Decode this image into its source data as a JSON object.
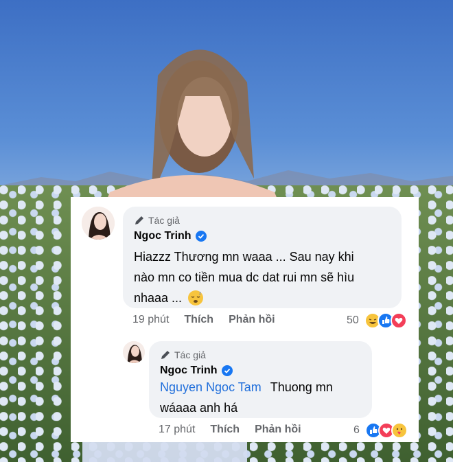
{
  "comments": [
    {
      "author_tag": "Tác giả",
      "name": "Ngoc Trinh",
      "text_line1": "Hiazzz Thương mn waaa ... Sau nay khi",
      "text_line2": "nào mn co tiền mua dc dat rui mn sẽ hìu",
      "text_line3": "nhaaa ...",
      "time": "19 phút",
      "like": "Thích",
      "reply": "Phản hồi",
      "reaction_count": "50",
      "reactions": [
        "haha",
        "like",
        "love"
      ]
    },
    {
      "author_tag": "Tác giả",
      "name": "Ngoc Trinh",
      "mention": "Nguyen Ngoc Tam",
      "text_line1": "Thuong mn",
      "text_line2": "wáaaa anh há",
      "time": "17 phút",
      "like": "Thích",
      "reply": "Phản hồi",
      "reaction_count": "6",
      "reactions": [
        "like",
        "love",
        "care"
      ]
    }
  ],
  "colors": {
    "bubble": "#f0f2f5",
    "verified": "#1877f2",
    "mention": "#216fdb",
    "muted": "#65676b"
  }
}
